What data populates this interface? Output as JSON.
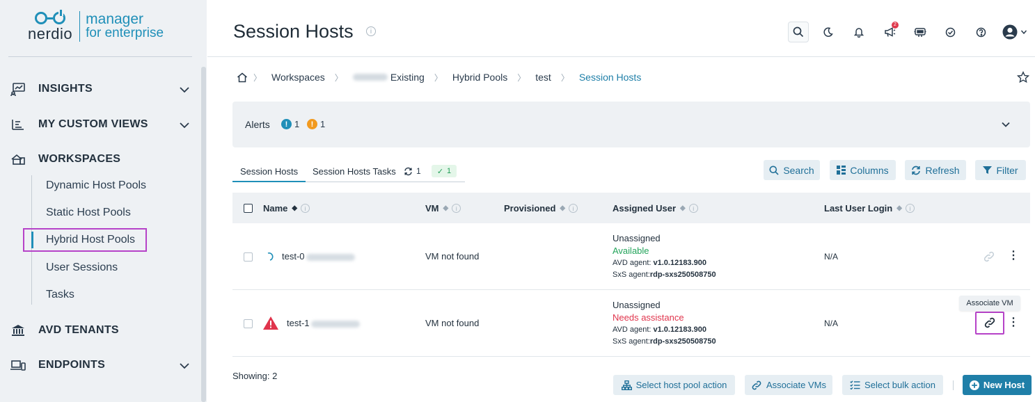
{
  "brand": {
    "word": "nerdio",
    "line1": "manager",
    "line2": "for enterprise",
    "accent": "#1f8fb8"
  },
  "sidebar": {
    "sections": [
      {
        "label": "INSIGHTS",
        "icon": "insights-icon"
      },
      {
        "label": "MY CUSTOM VIEWS",
        "icon": "custom-views-icon"
      },
      {
        "label": "WORKSPACES",
        "icon": "workspaces-icon"
      },
      {
        "label": "AVD TENANTS",
        "icon": "bank-icon"
      },
      {
        "label": "ENDPOINTS",
        "icon": "endpoints-icon"
      }
    ],
    "workspace_items": [
      "Dynamic Host Pools",
      "Static Host Pools",
      "Hybrid Host Pools",
      "User Sessions",
      "Tasks"
    ],
    "active_item": "Hybrid Host Pools"
  },
  "header": {
    "title": "Session Hosts",
    "info_glyph": "i",
    "notification_count": "2"
  },
  "breadcrumb": {
    "items": [
      "Workspaces",
      "Existing",
      "Hybrid Pools",
      "test"
    ],
    "current": "Session Hosts"
  },
  "alerts": {
    "label": "Alerts",
    "info_count": "1",
    "warning_count": "1",
    "info_color": "#1f8fb8",
    "warning_color": "#f29a1f"
  },
  "tabs": {
    "session_hosts": "Session Hosts",
    "tasks": "Session Hosts Tasks",
    "tasks_running": "1",
    "tasks_done": "1"
  },
  "toolbar": {
    "search": "Search",
    "columns": "Columns",
    "refresh": "Refresh",
    "filter": "Filter"
  },
  "table": {
    "headers": {
      "name": "Name",
      "vm": "VM",
      "provisioned": "Provisioned",
      "assigned_user": "Assigned User",
      "last_login": "Last User Login"
    },
    "rows": [
      {
        "name": "test-0",
        "vm": "VM not found",
        "assigned": "Unassigned",
        "status": "Available",
        "avd_label": "AVD agent: ",
        "avd_version": "v1.0.12183.900",
        "sxs_label": "SxS agent:",
        "sxs_version": "rdp-sxs250508750",
        "last_login": "N/A"
      },
      {
        "name": "test-1",
        "vm": "VM not found",
        "assigned": "Unassigned",
        "status": "Needs assistance",
        "avd_label": "AVD agent: ",
        "avd_version": "v1.0.12183.900",
        "sxs_label": "SxS agent:",
        "sxs_version": "rdp-sxs250508750",
        "last_login": "N/A"
      }
    ]
  },
  "tooltip": "Associate VM",
  "footer": {
    "showing": "Showing: 2",
    "select_host_pool_action": "Select host pool action",
    "associate_vms": "Associate VMs",
    "select_bulk_action": "Select bulk action",
    "new_host": "New Host"
  }
}
